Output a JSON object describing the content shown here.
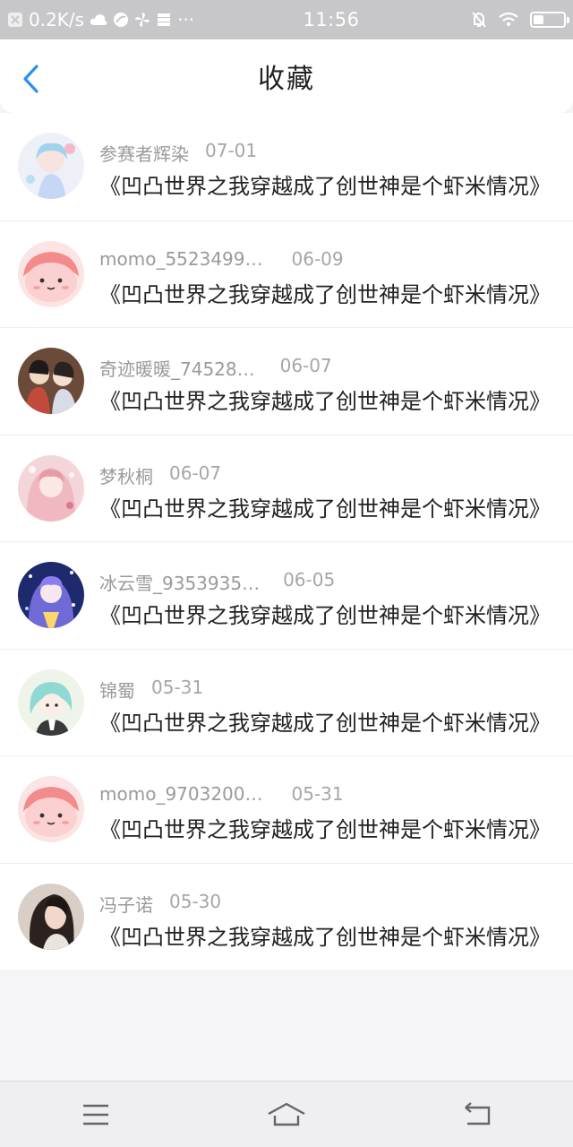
{
  "status_bar": {
    "net_speed": "0.2K/s",
    "more": "···",
    "time": "11:56",
    "battery_level": 0.35
  },
  "header": {
    "title": "收藏",
    "back_icon": "chevron-left-icon"
  },
  "items": [
    {
      "username": "参赛者辉染",
      "date": "07-01",
      "title": "《凹凸世界之我穿越成了创世神是个虾米情况》"
    },
    {
      "username": "momo_5523499…",
      "date": "06-09",
      "title": "《凹凸世界之我穿越成了创世神是个虾米情况》"
    },
    {
      "username": "奇迹暖暖_74528…",
      "date": "06-07",
      "title": "《凹凸世界之我穿越成了创世神是个虾米情况》"
    },
    {
      "username": "梦秋桐",
      "date": "06-07",
      "title": "《凹凸世界之我穿越成了创世神是个虾米情况》"
    },
    {
      "username": "冰云雪_9353935…",
      "date": "06-05",
      "title": "《凹凸世界之我穿越成了创世神是个虾米情况》"
    },
    {
      "username": "锦蜀",
      "date": "05-31",
      "title": "《凹凸世界之我穿越成了创世神是个虾米情况》"
    },
    {
      "username": "momo_9703200…",
      "date": "05-31",
      "title": "《凹凸世界之我穿越成了创世神是个虾米情况》"
    },
    {
      "username": "冯子诺",
      "date": "05-30",
      "title": "《凹凸世界之我穿越成了创世神是个虾米情况》"
    }
  ],
  "colors": {
    "accent": "#2a8ff0",
    "status_bar": "#c7c7c9",
    "text_primary": "#222222",
    "text_secondary": "#9a9a9a"
  },
  "nav": {
    "menu_icon": "menu-icon",
    "home_icon": "home-icon",
    "back_icon": "back-icon"
  }
}
